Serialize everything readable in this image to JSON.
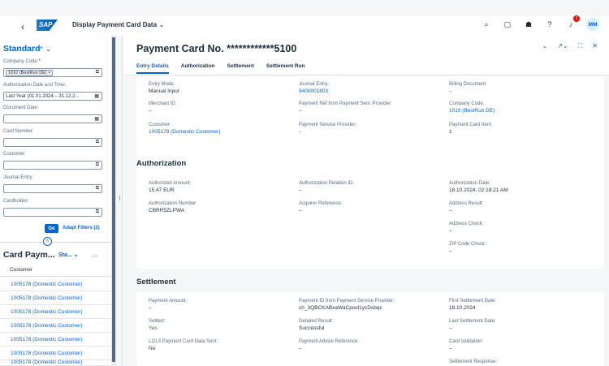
{
  "shell": {
    "app_title": "Display Payment Card Data",
    "logo_text": "SAP",
    "notification_count": "2",
    "avatar_initials": "MM"
  },
  "filterbar": {
    "variant_title": "Standard",
    "variant_marker": "*",
    "fields": [
      {
        "label": "Company Code:",
        "required": "*",
        "value": "",
        "token": "1010 (BestRun DE)"
      },
      {
        "label": "Authorization Date and Time:",
        "value": "Last Year (01.01.2024 – 31.12.2...",
        "token": ""
      },
      {
        "label": "Document Date:",
        "value": "",
        "token": ""
      },
      {
        "label": "Card Number:",
        "value": "",
        "token": ""
      },
      {
        "label": "Customer:",
        "value": "",
        "token": ""
      },
      {
        "label": "Journal Entry:",
        "value": "",
        "token": ""
      },
      {
        "label": "Cardholder:",
        "value": "",
        "token": ""
      }
    ],
    "go_label": "Go",
    "adapt_label": "Adapt Filters (2)"
  },
  "table": {
    "title": "Card Paym...",
    "variant": "Sta...",
    "column": "Customer",
    "rows": [
      "1005178 (Domestic Customer)",
      "1005178 (Domestic Customer)",
      "1005178 (Domestic Customer)",
      "1005178 (Domestic Customer)",
      "1005178 (Domestic Customer)",
      "1005178 (Domestic Customer)",
      "1005178 (Domestic Customer)"
    ]
  },
  "object": {
    "title": "Payment Card No. ************5100",
    "tabs": [
      "Entry Details",
      "Authorization",
      "Settlement",
      "Settlement Run"
    ],
    "entry": [
      {
        "label": "Entry Mode:",
        "value": "Manual Input",
        "kind": ""
      },
      {
        "label": "Journal Entry:",
        "value": "9400001803",
        "kind": "link"
      },
      {
        "label": "Billing Document:",
        "value": "–",
        "kind": "dash"
      },
      {
        "label": "Merchant ID:",
        "value": "–",
        "kind": ""
      },
      {
        "label": "Payment Ref from Payment Serv. Provider:",
        "value": "–",
        "kind": ""
      },
      {
        "label": "Company Code:",
        "value": "1010 (BestRun DE)",
        "kind": "link"
      },
      {
        "label": "Customer:",
        "value": "1005178 (Domestic Customer)",
        "kind": "link"
      },
      {
        "label": "Payment Service Provider:",
        "value": "–",
        "kind": "dash"
      },
      {
        "label": "Payment Card Item:",
        "value": "1",
        "kind": ""
      }
    ],
    "authorization_title": "Authorization",
    "authorization": [
      {
        "label": "Authorized Amount:",
        "value": "15.47    EUR",
        "kind": ""
      },
      {
        "label": "Authorization Relation ID:",
        "value": "–",
        "kind": ""
      },
      {
        "label": "Authorization Date:",
        "value": "18.10.2024, 02:18:21 AM",
        "kind": ""
      },
      {
        "label": "Authorization Number:",
        "value": "CBRR5ZLPWA",
        "kind": ""
      },
      {
        "label": "Acquirer Reference:",
        "value": "–",
        "kind": ""
      },
      {
        "label": "Address Result:",
        "value": "–",
        "kind": ""
      },
      {
        "label": "Address Check:",
        "value": "–",
        "kind": ""
      },
      {
        "label": "ZIP Code Check:",
        "value": "–",
        "kind": ""
      }
    ],
    "settlement_title": "Settlement",
    "settlement": [
      {
        "label": "Payment Amount:",
        "value": "–",
        "kind": ""
      },
      {
        "label": "Payment ID from Payment Service Provider:",
        "value": "ch_3QBCKABxaWaCpovl1ycDsbqc",
        "kind": ""
      },
      {
        "label": "First Settlement Date:",
        "value": "18.10.2024",
        "kind": ""
      },
      {
        "label": "Settled:",
        "value": "Yes",
        "kind": "pos"
      },
      {
        "label": "Detailed Result:",
        "value": "Successful",
        "kind": ""
      },
      {
        "label": "Last Settlement Date:",
        "value": "–",
        "kind": ""
      },
      {
        "label": "L2/L3 Payment Card Data Sent:",
        "value": "No",
        "kind": ""
      },
      {
        "label": "Payment Advice Reference:",
        "value": "–",
        "kind": ""
      },
      {
        "label": "Card Validation:",
        "value": "–",
        "kind": ""
      },
      {
        "label": "Settlement Response:",
        "value": "",
        "kind": ""
      }
    ]
  }
}
